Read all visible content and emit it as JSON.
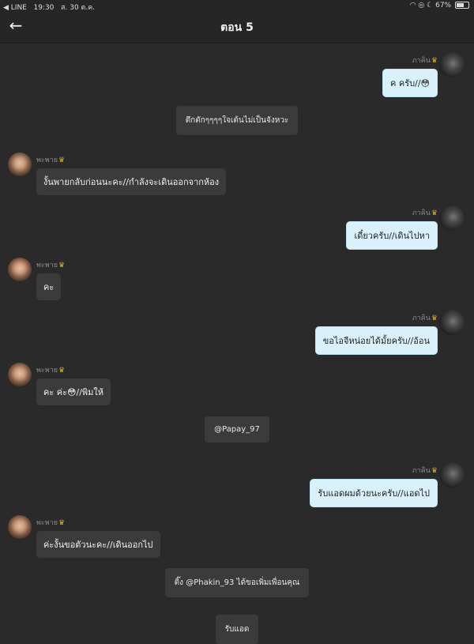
{
  "status_bar": {
    "carrier": "◀ LINE",
    "time": "19:30",
    "date": "ส. 30 ต.ค.",
    "battery": "67%",
    "battery_level": 0.67,
    "icons": [
      "wifi-icon",
      "location-icon",
      "moon-icon",
      "battery-icon"
    ]
  },
  "header": {
    "title": "ตอน 5",
    "back_icon": "arrow-left-icon"
  },
  "characters": {
    "boy": "ภาคิน",
    "girl": "พะพาย"
  },
  "messages": [
    {
      "side": "right",
      "name": "ภาคิน",
      "text": "ค ครับ//😳"
    },
    {
      "side": "narration",
      "text": "ตึกตักๆๆๆๆใจเต้นไม่เป็นจังหวะ"
    },
    {
      "side": "left",
      "name": "พะพาย",
      "text": "งั้นพายกลับก่อนนะคะ//กำลังจะเดินออกจากห้อง"
    },
    {
      "side": "right",
      "name": "ภาคิน",
      "text": "เดี๋ยวครับ//เดินไปหา"
    },
    {
      "side": "left",
      "name": "พะพาย",
      "text": "คะ"
    },
    {
      "side": "right",
      "name": "ภาคิน",
      "text": "ขอไอจีหน่อยได้มั้ยครับ//อ้อน"
    },
    {
      "side": "left",
      "name": "พะพาย",
      "text": "คะ ค่ะ😳//พิมให้"
    },
    {
      "side": "narration",
      "text": "@Papay_97"
    },
    {
      "side": "right",
      "name": "ภาคิน",
      "text": "รับแอดผมด้วยนะครับ//แอดไป"
    },
    {
      "side": "left",
      "name": "พะพาย",
      "text": "ค่ะงั้นขอตัวนะคะ//เดินออกไป"
    },
    {
      "side": "narration",
      "text": "ติ๊ง @Phakin_93 ได้ขอเพิ่มเพื่อนคุณ"
    },
    {
      "side": "narration",
      "text": "รับแอด"
    }
  ],
  "crown_icon": "♛",
  "colors": {
    "background": "#2a2a2a",
    "bubble_blue": "#d8f1fb",
    "bubble_dark": "#3b3b3b",
    "crown": "#d9b13a"
  }
}
